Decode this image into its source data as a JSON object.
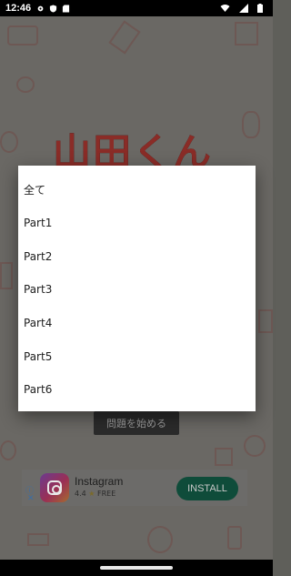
{
  "status_bar": {
    "time": "12:46"
  },
  "app": {
    "logo_text": "山田くん",
    "start_button_label": "問題を始める"
  },
  "ad": {
    "app_name": "Instagram",
    "rating": "4.4",
    "price": "FREE",
    "install_label": "INSTALL",
    "info_icon": "ⓘ",
    "close_icon": "✕"
  },
  "dialog": {
    "options": [
      "全て",
      "Part1",
      "Part2",
      "Part3",
      "Part4",
      "Part5",
      "Part6"
    ]
  }
}
